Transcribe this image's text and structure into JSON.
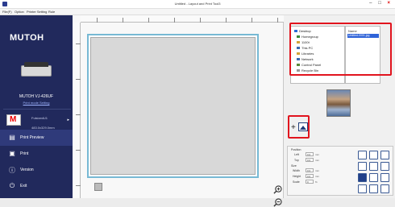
{
  "window": {
    "title": "Untitled - Layout and Print Tool3",
    "controls": [
      "–",
      "□",
      "×"
    ]
  },
  "menu": {
    "items": [
      "File(F)",
      "Option",
      "Printer Setting",
      "Rule"
    ]
  },
  "sidebar": {
    "logo": "MUTOH",
    "printer_name": "MUTOH VJ-426UF",
    "printer_link": "Print mode Setting",
    "media_label": "FulsizedU1",
    "media_size": "483.0x329.0mm",
    "nav": [
      {
        "label": "Print Preview",
        "icon": "print-preview-icon"
      },
      {
        "label": "Print",
        "icon": "printer-icon"
      },
      {
        "label": "Version",
        "icon": "info-icon"
      },
      {
        "label": "Exit",
        "icon": "power-icon"
      }
    ]
  },
  "file_browser": {
    "tree": [
      "Desktop",
      "Homegroup",
      "1100t",
      "This PC",
      "Libraries",
      "Network",
      "Control Panel",
      "Recycle Bin"
    ],
    "list_header": "Name",
    "selected_file": "Untitled-0001.jpg"
  },
  "properties": {
    "position_label": "Position",
    "left_label": "Left",
    "top_label": "Top",
    "size_label": "Size",
    "width_label": "Width",
    "height_label": "Height",
    "scale_label": "Scale",
    "left_value": "0.0",
    "top_value": "0.0",
    "width_value": "0.0",
    "height_value": "0.0",
    "scale_value": "0",
    "unit_mm": "mm",
    "unit_pct": "%"
  },
  "colors": {
    "sidebar": "#21295c",
    "highlight": "#e1141e",
    "media_border": "#77b9d4",
    "accent": "#2f63d8"
  }
}
